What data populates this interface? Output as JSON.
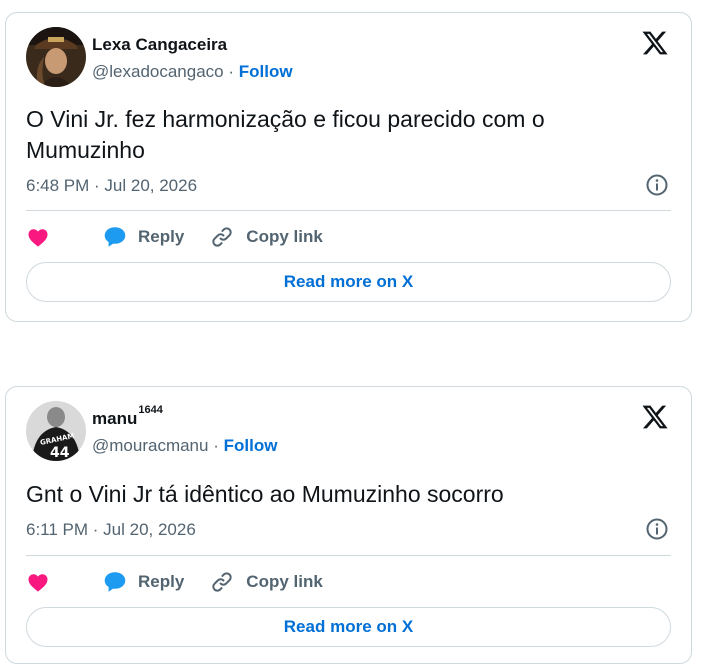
{
  "colors": {
    "text_primary": "#0f1419",
    "text_secondary": "#536471",
    "link_blue": "#006fd6",
    "like_pink": "#f91880",
    "reply_blue": "#1d9bf0",
    "border": "#cfd9de"
  },
  "tweets": [
    {
      "display_name": "Lexa Cangaceira",
      "name_superscript": "",
      "handle": "@lexadocangaco",
      "separator": "·",
      "follow_label": "Follow",
      "text": "O Vini Jr. fez harmonização e ficou parecido com o Mumuzinho",
      "timestamp": "6:48 PM · Jul 20, 2026",
      "reply_label": "Reply",
      "copy_link_label": "Copy link",
      "read_more_label": "Read more on X",
      "icons": {
        "avatar": "avatar",
        "brand": "x-logo-icon",
        "info": "info-icon",
        "like": "heart-icon",
        "reply": "speech-bubble-icon",
        "copy": "link-icon"
      }
    },
    {
      "display_name": "manu",
      "name_superscript": "1644",
      "handle": "@mouracmanu",
      "separator": "·",
      "follow_label": "Follow",
      "text": "Gnt o Vini Jr tá idêntico ao Mumuzinho socorro",
      "timestamp": "6:11 PM · Jul 20, 2026",
      "reply_label": "Reply",
      "copy_link_label": "Copy link",
      "read_more_label": "Read more on X",
      "icons": {
        "avatar": "avatar",
        "brand": "x-logo-icon",
        "info": "info-icon",
        "like": "heart-icon",
        "reply": "speech-bubble-icon",
        "copy": "link-icon"
      }
    }
  ]
}
